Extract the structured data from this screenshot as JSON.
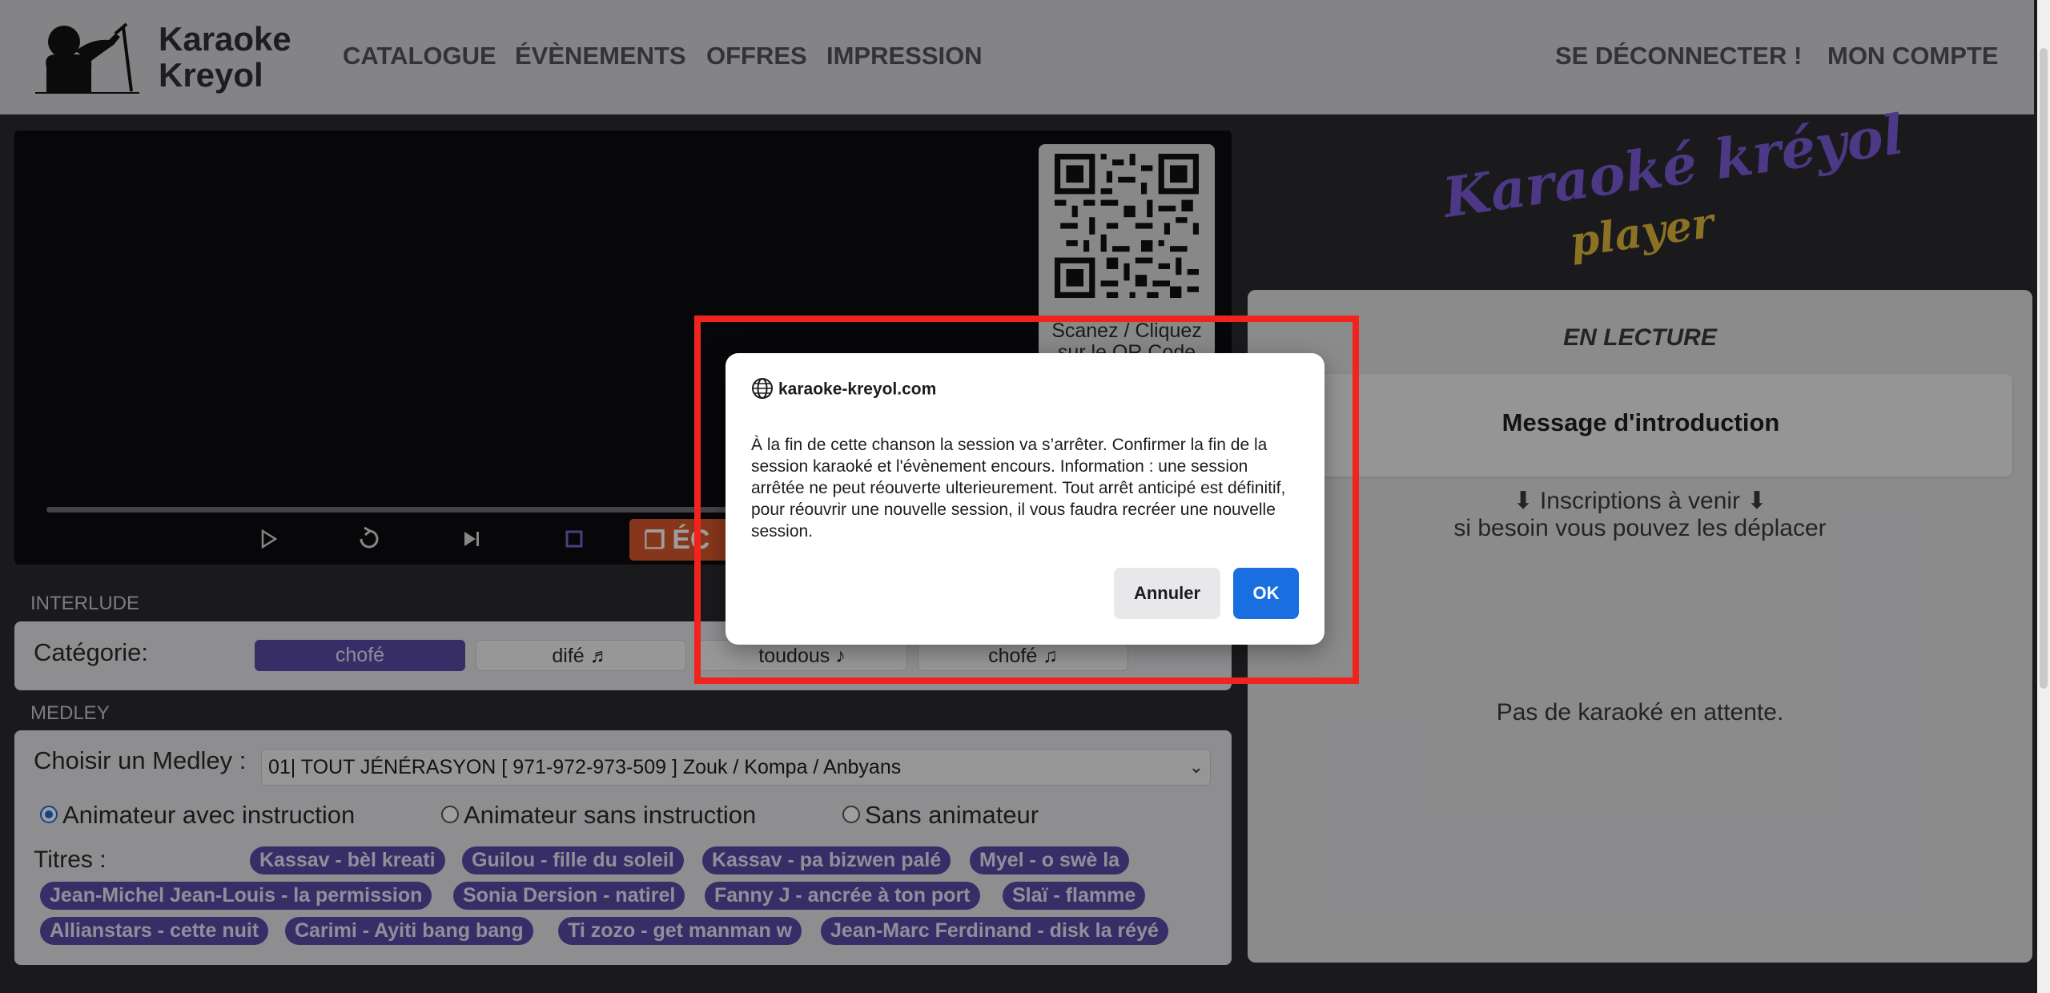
{
  "header": {
    "brand_line1": "Karaoke",
    "brand_line2": "Kreyol",
    "nav": [
      "CATALOGUE",
      "ÉVÈNEMENTS",
      "OFFRES",
      "IMPRESSION"
    ],
    "logout": "SE DÉCONNECTER !",
    "account": "MON COMPTE"
  },
  "player": {
    "qr_caption": "Scanez / Cliquez sur le QR Code",
    "ecran_label": "ÉC",
    "controls": [
      "play-icon",
      "replay-icon",
      "skip-next-icon",
      "stop-icon"
    ]
  },
  "interlude": {
    "section": "INTERLUDE",
    "category_label": "Catégorie:",
    "categories": [
      {
        "label": "chofé",
        "active": true
      },
      {
        "label": "difé ♬",
        "active": false
      },
      {
        "label": "toudous ♪",
        "active": false
      },
      {
        "label": "chofé ♫",
        "active": false
      }
    ]
  },
  "medley": {
    "section": "MEDLEY",
    "choose_label": "Choisir un Medley :",
    "selected": "01| TOUT JÉNÉRASYON [ 971-972-973-509 ] Zouk / Kompa / Anbyans",
    "radios": [
      {
        "label": "Animateur avec instruction",
        "checked": true
      },
      {
        "label": "Animateur sans instruction",
        "checked": false
      },
      {
        "label": "Sans animateur",
        "checked": false
      }
    ],
    "titles_label": "Titres :",
    "titles": [
      "Kassav - bèl kreati",
      "Guilou - fille du soleil",
      "Kassav - pa bizwen palé",
      "Myel - o swè la",
      "Jean-Michel Jean-Louis - la permission",
      "Sonia Dersion - natirel",
      "Fanny J - ancrée à ton port",
      "Slaï - flamme",
      "Allianstars - cette nuit",
      "Carimi - Ayiti bang bang",
      "Ti zozo - get manman w",
      "Jean-Marc Ferdinand - disk la réyé"
    ]
  },
  "right": {
    "logo_line1": "Karaoké kréyol",
    "logo_line2": "player",
    "now_playing_heading": "EN LECTURE",
    "now_playing_title": "Message d'introduction",
    "upcoming_line1": "⬇ Inscriptions à venir ⬇",
    "upcoming_line2": "si besoin vous pouvez les déplacer",
    "empty": "Pas de karaoké en attente."
  },
  "dialog": {
    "domain": "karaoke-kreyol.com",
    "message": "À la fin de cette chanson la session va s’arrêter. Confirmer la fin de la session karaoké et l'évènement encours. Information : une session arrêtée ne peut réouverte ulterieurement. Tout arrêt anticipé est définitif, pour réouvrir une nouvelle session, il vous faudra recréer une nouvelle session.",
    "cancel": "Annuler",
    "ok": "OK"
  },
  "colors": {
    "accent_purple": "#5a4ba8",
    "ok_blue": "#1a6fe0",
    "highlight_red": "#f0231d",
    "ecran_orange": "#d85a2c",
    "logo_purple": "#7b5bd6",
    "logo_gold": "#e0b63a"
  }
}
